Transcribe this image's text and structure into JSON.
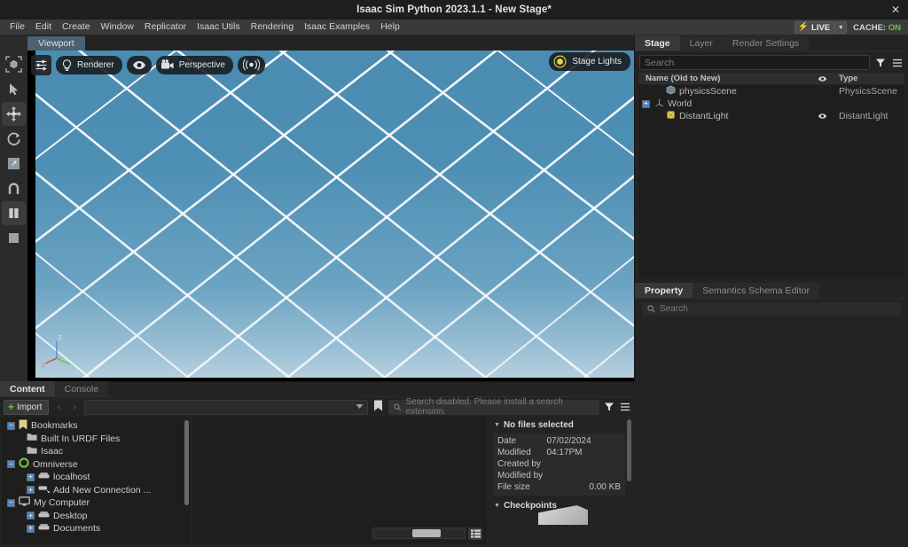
{
  "window": {
    "title": "Isaac Sim Python 2023.1.1 - New Stage*",
    "close_label": "✕"
  },
  "menubar": {
    "items": [
      {
        "label": "File"
      },
      {
        "label": "Edit"
      },
      {
        "label": "Create"
      },
      {
        "label": "Window"
      },
      {
        "label": "Replicator"
      },
      {
        "label": "Isaac Utils"
      },
      {
        "label": "Rendering"
      },
      {
        "label": "Isaac Examples"
      },
      {
        "label": "Help"
      }
    ],
    "live_label": "LIVE",
    "cache_label": "CACHE:",
    "cache_value": "ON",
    "cache_color": "#6fc04a",
    "bolt_color": "#e8d020"
  },
  "left_toolbar": {
    "tools": [
      {
        "name": "select-box-tool",
        "active": false
      },
      {
        "name": "select-arrow-tool",
        "active": false
      },
      {
        "name": "move-tool",
        "active": true
      },
      {
        "name": "rotate-tool",
        "active": false
      },
      {
        "name": "scale-tool",
        "active": false
      },
      {
        "name": "snap-tool",
        "active": false
      },
      {
        "name": "pause-tool",
        "active": true
      },
      {
        "name": "stop-tool",
        "active": false
      }
    ]
  },
  "viewport": {
    "tab_label": "Viewport",
    "toolbar": {
      "settings_icon": "sliders-icon",
      "renderer_label": "Renderer",
      "renderer_icon": "bulb-icon",
      "visibility_icon": "eye-icon",
      "camera_label": "Perspective",
      "camera_icon": "camera-icon",
      "audio_icon": "speaker-icon",
      "stage_lights_label": "Stage Lights",
      "stage_lights_icon": "sun-icon"
    },
    "axis": {
      "x": "X",
      "y": "Y",
      "z": "Z",
      "x_color": "#d4453c",
      "y_color": "#68c23a",
      "z_color": "#4a8fd4"
    },
    "ground_color": "#4a8cb2",
    "grid_line_color": "#ffffff"
  },
  "stage_panel": {
    "tabs": [
      {
        "label": "Stage",
        "active": true
      },
      {
        "label": "Layer",
        "active": false
      },
      {
        "label": "Render Settings",
        "active": false
      }
    ],
    "search_placeholder": "Search",
    "columns": {
      "name": "Name (Old to New)",
      "eye": "eye-icon",
      "type": "Type"
    },
    "rows": [
      {
        "name": "physicsScene",
        "type": "PhysicsScene",
        "icon": "cube-icon",
        "expandable": false,
        "eye": false
      },
      {
        "name": "World",
        "type": "",
        "icon": "axis-icon",
        "expandable": true,
        "eye": false
      },
      {
        "name": "DistantLight",
        "type": "DistantLight",
        "icon": "light-icon",
        "expandable": false,
        "eye": true
      }
    ]
  },
  "property_panel": {
    "tabs": [
      {
        "label": "Property",
        "active": true
      },
      {
        "label": "Semantics Schema Editor",
        "active": false
      }
    ],
    "search_placeholder": "Search"
  },
  "bottom_panel": {
    "tabs": [
      {
        "label": "Content",
        "active": true
      },
      {
        "label": "Console",
        "active": false
      }
    ],
    "import_label": "Import",
    "back_label": "‹",
    "forward_label": "›",
    "path_value": "",
    "search_placeholder": "Search disabled. Please install a search extension.",
    "tree": [
      {
        "label": "Bookmarks",
        "icon": "bookmark-icon",
        "indent": 0,
        "expander": "minus"
      },
      {
        "label": "Built In URDF Files",
        "icon": "folder-icon",
        "indent": 1,
        "expander": "none"
      },
      {
        "label": "Isaac",
        "icon": "folder-icon",
        "indent": 1,
        "expander": "none"
      },
      {
        "label": "Omniverse",
        "icon": "omniverse-icon",
        "indent": 0,
        "expander": "minus"
      },
      {
        "label": "localhost",
        "icon": "server-icon",
        "indent": 1,
        "expander": "plus"
      },
      {
        "label": "Add New Connection ...",
        "icon": "add-server-icon",
        "indent": 1,
        "expander": "plus"
      },
      {
        "label": "My Computer",
        "icon": "monitor-icon",
        "indent": 0,
        "expander": "minus"
      },
      {
        "label": "Desktop",
        "icon": "drive-icon",
        "indent": 1,
        "expander": "plus"
      },
      {
        "label": "Documents",
        "icon": "drive-icon",
        "indent": 1,
        "expander": "plus"
      }
    ],
    "info": {
      "selection_label": "No files selected",
      "date_modified_label": "Date Modified",
      "date_modified_value": "07/02/2024 04:17PM",
      "created_by_label": "Created by",
      "created_by_value": "",
      "modified_by_label": "Modified by",
      "modified_by_value": "",
      "file_size_label": "File size",
      "file_size_value": "0.00 KB",
      "checkpoints_label": "Checkpoints"
    }
  }
}
